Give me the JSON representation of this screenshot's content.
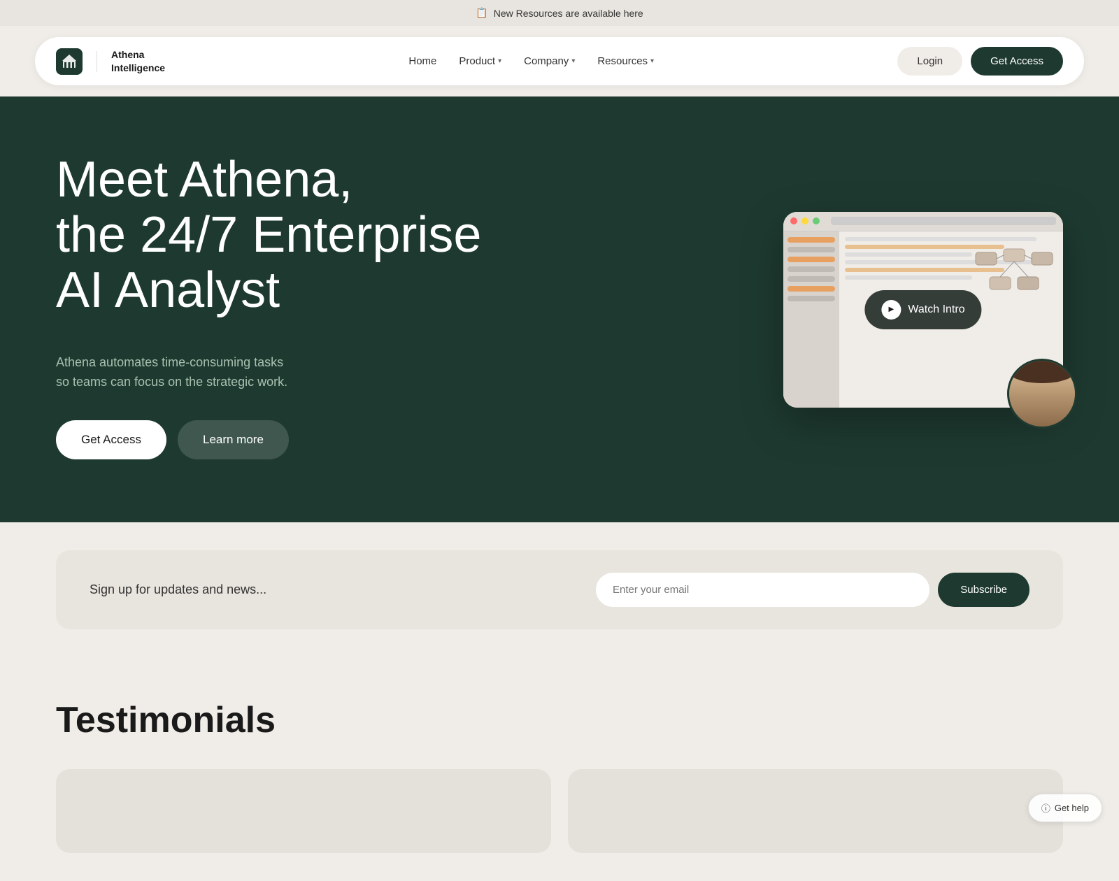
{
  "banner": {
    "icon": "📋",
    "text": "New Resources are available here"
  },
  "navbar": {
    "logo": {
      "icon": "🏛",
      "line1": "Athena",
      "line2": "Intelligence"
    },
    "nav_items": [
      {
        "label": "Home",
        "has_dropdown": false
      },
      {
        "label": "Product",
        "has_dropdown": true
      },
      {
        "label": "Company",
        "has_dropdown": true
      },
      {
        "label": "Resources",
        "has_dropdown": true
      }
    ],
    "login_label": "Login",
    "get_access_label": "Get Access"
  },
  "hero": {
    "title_line1": "Meet Athena,",
    "title_line2": "the 24/7 Enterprise",
    "title_line3": "AI Analyst",
    "description_line1": "Athena automates time-consuming tasks",
    "description_line2": "so teams can focus on the strategic work.",
    "btn_primary": "Get Access",
    "btn_secondary": "Learn more",
    "watch_intro": "Watch Intro"
  },
  "newsletter": {
    "label": "Sign up for updates and news...",
    "input_placeholder": "Enter your email",
    "btn_subscribe": "Subscribe"
  },
  "testimonials": {
    "title": "Testimonials"
  },
  "help": {
    "label": "Get help"
  },
  "colors": {
    "dark_green": "#1e3a30",
    "bg_cream": "#f0ede8",
    "card_bg": "#e8e4de"
  }
}
